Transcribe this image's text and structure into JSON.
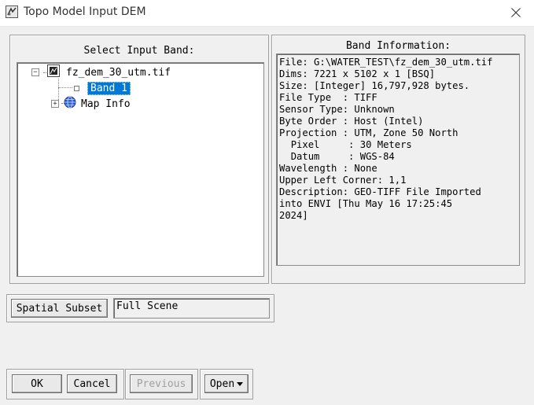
{
  "window": {
    "title": "Topo Model Input DEM"
  },
  "select_panel": {
    "title": "Select Input Band:",
    "tree": {
      "file_node": "fz_dem_30_utm.tif",
      "band_node": "Band 1",
      "map_info_node": "Map Info"
    }
  },
  "info_panel": {
    "title": "Band Information:",
    "text": "File: G:\\WATER_TEST\\fz_dem_30_utm.tif\nDims: 7221 x 5102 x 1 [BSQ]\nSize: [Integer] 16,797,928 bytes.\nFile Type  : TIFF\nSensor Type: Unknown\nByte Order : Host (Intel)\nProjection : UTM, Zone 50 North\n  Pixel     : 30 Meters\n  Datum     : WGS-84\nWavelength : None\nUpper Left Corner: 1,1\nDescription: GEO-TIFF File Imported\ninto ENVI [Thu May 16 17:25:45\n2024]"
  },
  "subset": {
    "button_label": "Spatial Subset",
    "value": "Full Scene"
  },
  "buttons": {
    "ok": "OK",
    "cancel": "Cancel",
    "previous": "Previous",
    "open": "Open"
  },
  "icons": {
    "app": "envi-app-icon",
    "close": "close-icon",
    "file": "image-file-icon",
    "map": "globe-icon",
    "dropdown": "caret-down-icon"
  },
  "colors": {
    "selection": "#0078d7",
    "window_bg": "#f0f0f0"
  }
}
